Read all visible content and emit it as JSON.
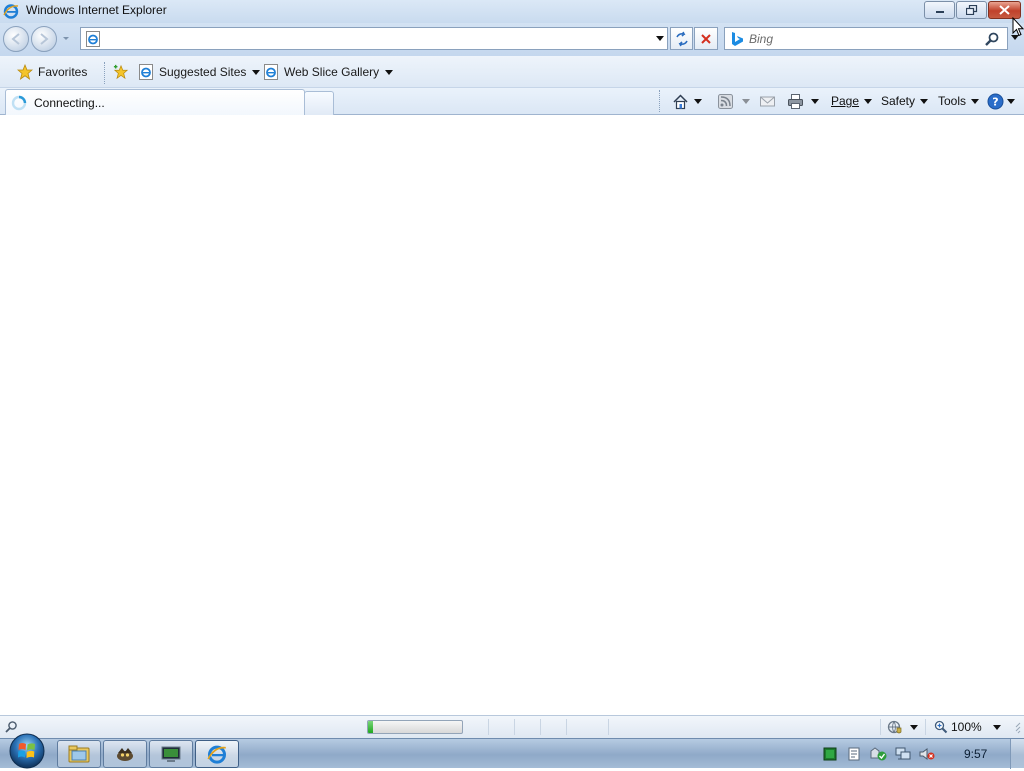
{
  "window": {
    "title": "Windows Internet Explorer",
    "app_icon": "ie-logo-icon",
    "caption_buttons": [
      "minimize-icon",
      "restore-icon",
      "close-icon"
    ]
  },
  "navigation": {
    "back_icon": "back-arrow-icon",
    "forward_icon": "forward-arrow-icon",
    "address": {
      "value": "",
      "page_icon": "ie-page-icon"
    },
    "refresh_icon": "refresh-icon",
    "stop_icon": "stop-icon",
    "search": {
      "placeholder": "Bing",
      "value": "",
      "provider_icon": "bing-icon",
      "go_icon": "magnifier-icon"
    }
  },
  "favorites_bar": {
    "favorites_label": "Favorites",
    "items": [
      {
        "label": "Suggested Sites",
        "icon": "ie-page-icon"
      },
      {
        "label": "Web Slice Gallery",
        "icon": "ie-page-icon"
      }
    ]
  },
  "tabs": {
    "active": {
      "label": "Connecting...",
      "icon": "loading-spinner-icon"
    },
    "new_tab_icon": "new-tab-icon"
  },
  "command_bar": {
    "home_icon": "home-icon",
    "feeds_icon": "rss-feed-icon",
    "read_mail_icon": "mail-icon",
    "print_icon": "printer-icon",
    "page_label": "Page",
    "safety_label": "Safety",
    "tools_label": "Tools",
    "help_icon": "help-icon"
  },
  "status_bar": {
    "progress_fraction": 0.05,
    "protected_mode_icon": "protected-mode-icon",
    "zoom_label": "100%"
  },
  "taskbar": {
    "start_icon": "windows-start-orb-icon",
    "pinned": [
      {
        "icon": "folder-explorer-icon",
        "active": false
      },
      {
        "icon": "game-icon",
        "active": false
      },
      {
        "icon": "console-icon",
        "active": false
      },
      {
        "icon": "internet-explorer-icon",
        "active": true
      }
    ],
    "tray_icons": [
      "tray-green-icon",
      "tray-doc-icon",
      "action-center-icon",
      "network-icon",
      "volume-muted-icon"
    ],
    "clock": "9:57"
  },
  "colors": {
    "close_button": "#c0412b",
    "progress_fill": "#1fa81f",
    "ie_blue": "#1f7fd6"
  }
}
